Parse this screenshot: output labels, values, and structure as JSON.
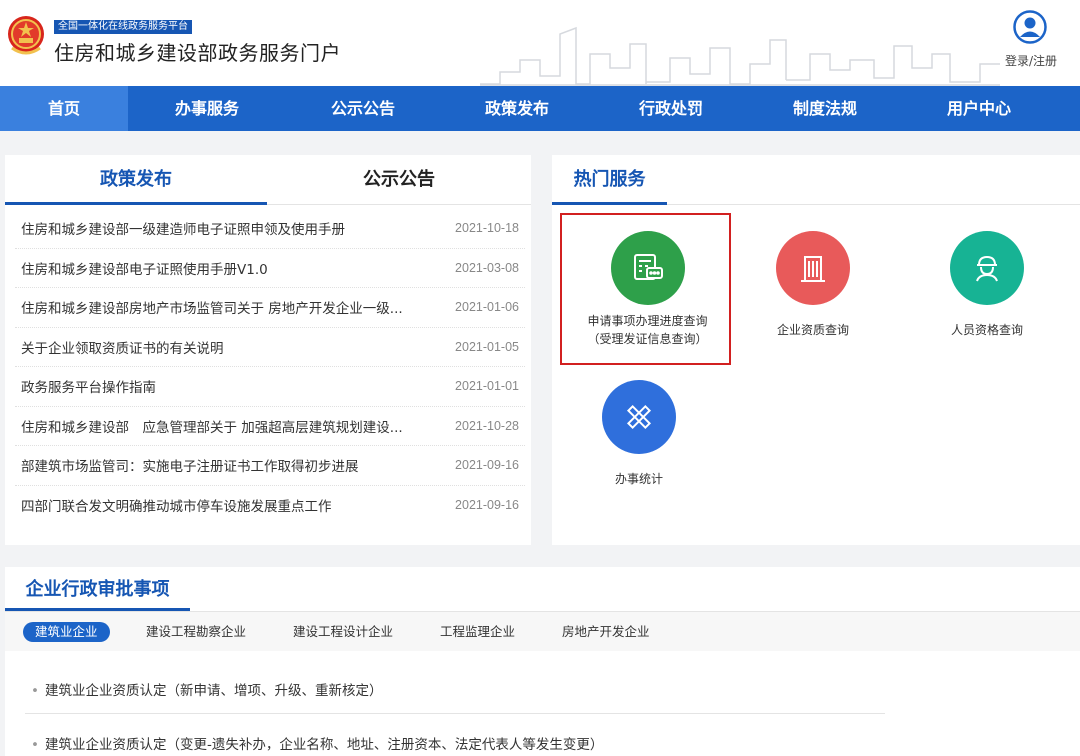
{
  "header": {
    "badge": "全国一体化在线政务服务平台",
    "site_title": "住房和城乡建设部政务服务门户",
    "login_label": "登录/注册"
  },
  "nav": {
    "items": [
      "首页",
      "办事服务",
      "公示公告",
      "政策发布",
      "行政处罚",
      "制度法规",
      "用户中心"
    ]
  },
  "left_panel": {
    "tabs": [
      "政策发布",
      "公示公告"
    ],
    "items": [
      {
        "title": "住房和城乡建设部一级建造师电子证照申领及使用手册",
        "date": "2021-10-18"
      },
      {
        "title": "住房和城乡建设部电子证照使用手册V1.0",
        "date": "2021-03-08"
      },
      {
        "title": "住房和城乡建设部房地产市场监管司关于 房地产开发企业一级...",
        "date": "2021-01-06"
      },
      {
        "title": "关于企业领取资质证书的有关说明",
        "date": "2021-01-05"
      },
      {
        "title": "政务服务平台操作指南",
        "date": "2021-01-01"
      },
      {
        "title": "住房和城乡建设部　应急管理部关于 加强超高层建筑规划建设...",
        "date": "2021-10-28"
      },
      {
        "title": "部建筑市场监管司：实施电子注册证书工作取得初步进展",
        "date": "2021-09-16"
      },
      {
        "title": "四部门联合发文明确推动城市停车设施发展重点工作",
        "date": "2021-09-16"
      }
    ]
  },
  "hot_services": {
    "title": "热门服务",
    "items": [
      {
        "label_line1": "申请事项办理进度查询",
        "label_line2": "（受理发证信息查询）",
        "icon": "calculator-chat-icon",
        "color": "#2ea04a"
      },
      {
        "label_line1": "企业资质查询",
        "icon": "building-icon",
        "color": "#e85a5a"
      },
      {
        "label_line1": "人员资格查询",
        "icon": "worker-icon",
        "color": "#17b394"
      },
      {
        "label_line1": "办事统计",
        "icon": "ruler-pencil-icon",
        "color": "#2f6fdc"
      }
    ]
  },
  "approval": {
    "title": "企业行政审批事项",
    "subtabs": [
      "建筑业企业",
      "建设工程勘察企业",
      "建设工程设计企业",
      "工程监理企业",
      "房地产开发企业"
    ],
    "items": [
      "建筑业企业资质认定（新申请、增项、升级、重新核定）",
      "建筑业企业资质认定（变更-遗失补办，企业名称、地址、注册资本、法定代表人等发生变更）"
    ]
  }
}
